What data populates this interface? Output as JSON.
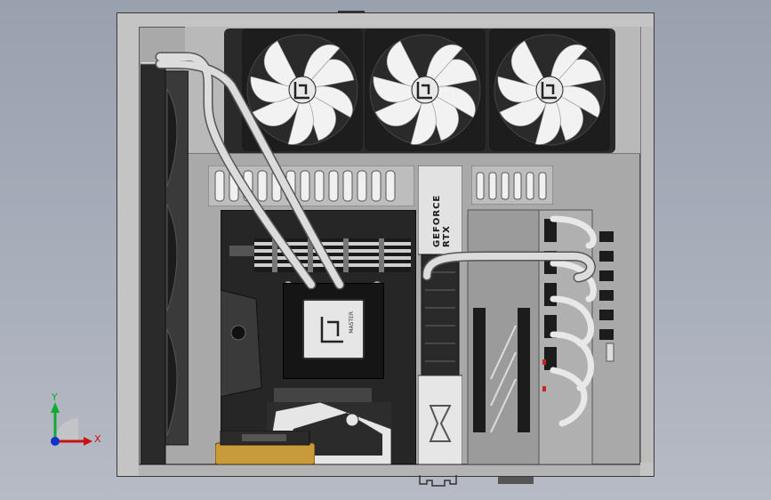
{
  "model": {
    "gpu_label": "GEFORCE RTX",
    "cpu_block_label": "MASTER"
  },
  "triad": {
    "x_label": "X",
    "y_label": "Y"
  },
  "colors": {
    "chassis": "#c4c4c4",
    "fan_blade": "#f2f2f2",
    "fan_frame": "#1d1d1d",
    "motherboard": "#262626",
    "tube": "#d8d8d8",
    "cooler_copper": "#c99a3a",
    "axis_x": "#cc1111",
    "axis_y": "#11aa33",
    "axis_z": "#1133cc"
  }
}
